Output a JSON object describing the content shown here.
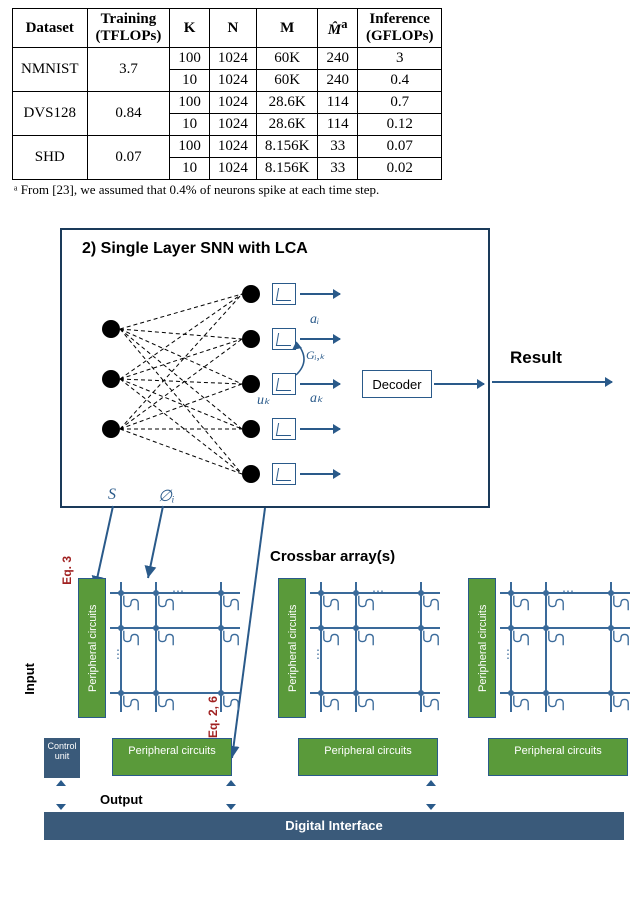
{
  "table": {
    "headers": [
      "Dataset",
      "Training\n(TFLOPs)",
      "K",
      "N",
      "M",
      "M̂ᵃ",
      "Inference\n(GFLOPs)"
    ],
    "groups": [
      {
        "dataset": "NMNIST",
        "training": "3.7",
        "rows": [
          {
            "K": "100",
            "N": "1024",
            "M": "60K",
            "Mhat": "240",
            "Inf": "3"
          },
          {
            "K": "10",
            "N": "1024",
            "M": "60K",
            "Mhat": "240",
            "Inf": "0.4"
          }
        ]
      },
      {
        "dataset": "DVS128",
        "training": "0.84",
        "rows": [
          {
            "K": "100",
            "N": "1024",
            "M": "28.6K",
            "Mhat": "114",
            "Inf": "0.7"
          },
          {
            "K": "10",
            "N": "1024",
            "M": "28.6K",
            "Mhat": "114",
            "Inf": "0.12"
          }
        ]
      },
      {
        "dataset": "SHD",
        "training": "0.07",
        "rows": [
          {
            "K": "100",
            "N": "1024",
            "M": "8.156K",
            "Mhat": "33",
            "Inf": "0.07"
          },
          {
            "K": "10",
            "N": "1024",
            "M": "8.156K",
            "Mhat": "33",
            "Inf": "0.02"
          }
        ]
      }
    ]
  },
  "footnote": "ᵃ From [23], we assumed that 0.4% of neurons spike at each time step.",
  "snn": {
    "title": "2)  Single Layer SNN with LCA",
    "decoder": "Decoder",
    "result": "Result",
    "labels": {
      "S": "S",
      "phi": "∅ᵢ",
      "ai": "aᵢ",
      "Gik": "Gᵢ,ₖ",
      "uk": "uₖ",
      "ak": "aₖ"
    }
  },
  "crossbar": {
    "title": "Crossbar array(s)",
    "periph": "Peripheral circuits",
    "control": "Control unit",
    "digital": "Digital Interface",
    "input": "Input",
    "output": "Output",
    "eq3": "Eq. 3",
    "eq26": "Eq. 2, 6"
  }
}
